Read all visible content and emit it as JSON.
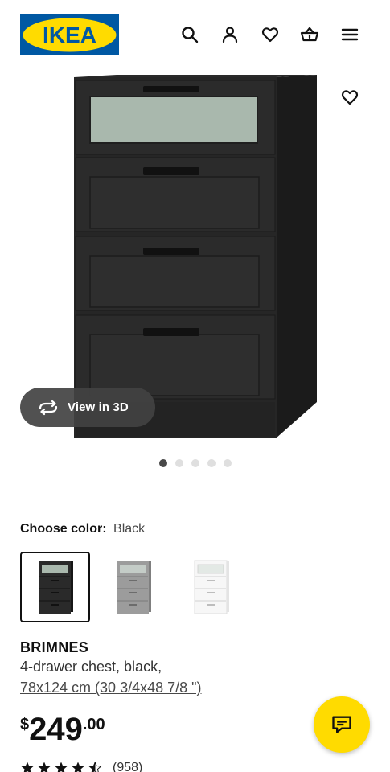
{
  "header": {
    "logo_text": "IKEA",
    "icons": [
      "search-icon",
      "account-icon",
      "wishlist-icon",
      "cart-icon",
      "menu-icon"
    ]
  },
  "gallery": {
    "view_3d_label": "View in 3D",
    "active_index": 0,
    "image_count": 5
  },
  "color": {
    "label": "Choose color:",
    "value": "Black",
    "options": [
      "Black",
      "Gray",
      "White"
    ],
    "selected": "Black"
  },
  "product": {
    "name": "BRIMNES",
    "description": "4-drawer chest, black,",
    "size": "78x124 cm (30 3/4x48 7/8 \")"
  },
  "price": {
    "currency": "$",
    "integer": "249",
    "decimal": ".00"
  },
  "rating": {
    "stars": 4.5,
    "count": "(958)"
  },
  "colors": {
    "ikea_blue": "#0058a3",
    "ikea_yellow": "#ffdb00"
  }
}
